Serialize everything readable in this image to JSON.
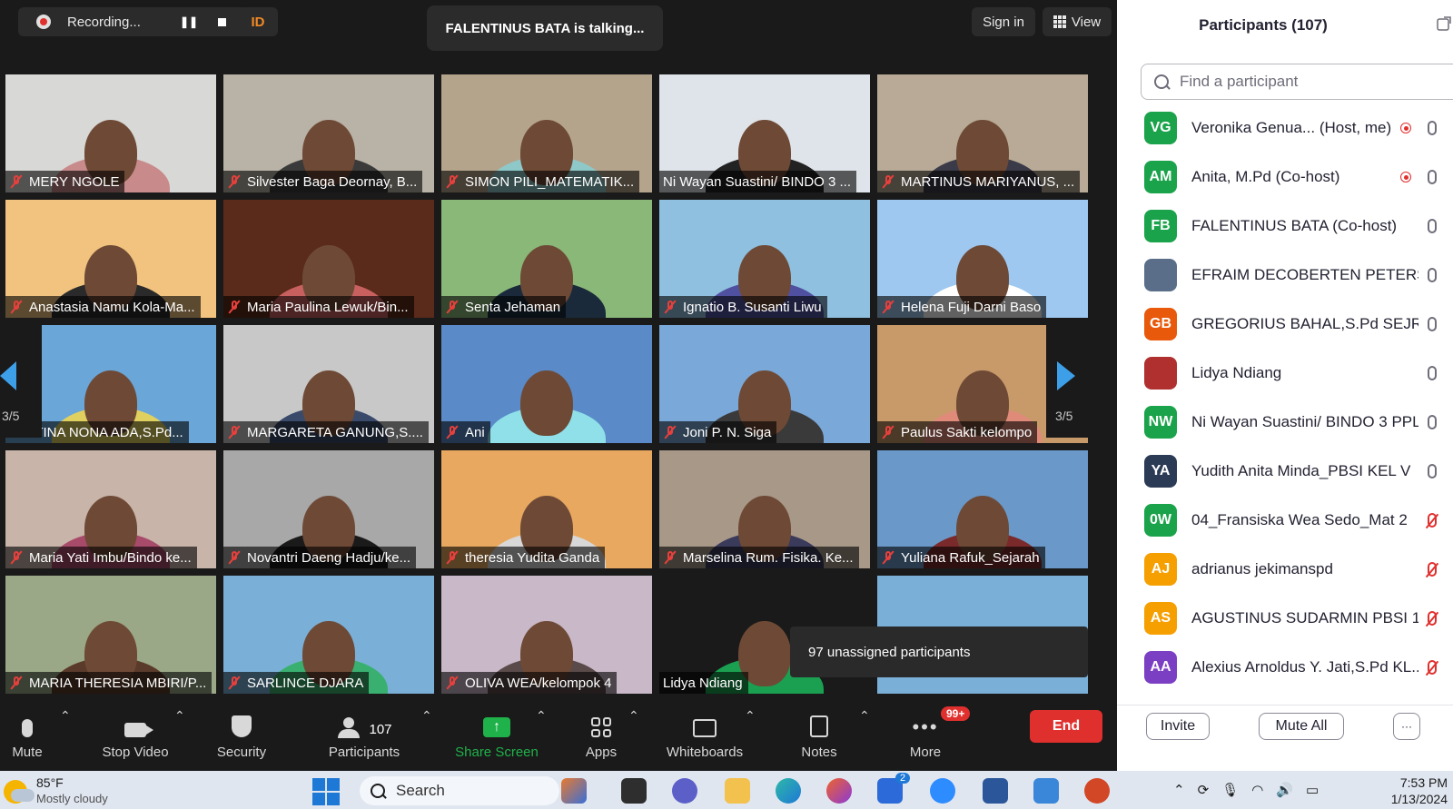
{
  "topbar": {
    "recording_label": "Recording...",
    "id_label": "ID",
    "talking_label": "FALENTINUS BATA is talking...",
    "sign_in_label": "Sign in",
    "view_label": "View"
  },
  "grid": {
    "page_indicator": "3/5",
    "unassigned_label": "97 unassigned participants",
    "tiles": [
      {
        "name": "MERY NGOLE",
        "muted": true
      },
      {
        "name": "Silvester Baga Deornay, B...",
        "muted": true
      },
      {
        "name": "SIMON PILI_MATEMATIK...",
        "muted": true
      },
      {
        "name": "Ni Wayan Suastini/ BINDO 3 ...",
        "muted": false
      },
      {
        "name": "MARTINUS MARIYANUS, ...",
        "muted": true
      },
      {
        "name": "Anastasia Namu Kola-Ma...",
        "muted": true
      },
      {
        "name": "Maria Paulina Lewuk/Bin...",
        "muted": true
      },
      {
        "name": "Senta Jehaman",
        "muted": true
      },
      {
        "name": "Ignatio B. Susanti Liwu",
        "muted": true
      },
      {
        "name": "Helena Fuji Darni Baso",
        "muted": true
      },
      {
        "name": "JUSTINA NONA ADA,S.Pd...",
        "muted": false
      },
      {
        "name": "MARGARETA GANUNG,S....",
        "muted": true
      },
      {
        "name": "Ani",
        "muted": true
      },
      {
        "name": "Joni P. N. Siga",
        "muted": true
      },
      {
        "name": "Paulus Sakti  kelompo",
        "muted": true
      },
      {
        "name": "Maria Yati Imbu/Bindo ke...",
        "muted": true
      },
      {
        "name": "Novantri Daeng Hadju/ke...",
        "muted": true
      },
      {
        "name": "theresia Yudita Ganda",
        "muted": true
      },
      {
        "name": "Marselina Rum. Fisika. Ke...",
        "muted": true
      },
      {
        "name": "Yuliana Rafuk_Sejarah",
        "muted": true
      },
      {
        "name": "MARIA THERESIA MBIRI/P...",
        "muted": true
      },
      {
        "name": "SARLINCE DJARA",
        "muted": true
      },
      {
        "name": "OLIVA WEA/kelompok 4",
        "muted": true
      },
      {
        "name": "Lidya Ndiang",
        "muted": false
      },
      {
        "name": "",
        "muted": false
      }
    ]
  },
  "toolbar": {
    "mute": "Mute",
    "stop_video": "Stop Video",
    "security": "Security",
    "participants": "Participants",
    "participants_count": "107",
    "share_screen": "Share Screen",
    "apps": "Apps",
    "whiteboards": "Whiteboards",
    "notes": "Notes",
    "more": "More",
    "more_badge": "99+",
    "end": "End"
  },
  "panel": {
    "title": "Participants (107)",
    "search_placeholder": "Find a participant",
    "participants": [
      {
        "initials": "VG",
        "color": "#1aa34a",
        "name": "Veronika Genua...   (Host, me)",
        "recording": true,
        "mic": "on"
      },
      {
        "initials": "AM",
        "color": "#1aa34a",
        "name": "Anita, M.Pd (Co-host)",
        "recording": true,
        "mic": "on"
      },
      {
        "initials": "FB",
        "color": "#1aa34a",
        "name": "FALENTINUS BATA (Co-host)",
        "recording": false,
        "mic": "on"
      },
      {
        "initials": "",
        "color": "#5a6e8a",
        "name": "EFRAIM DECOBERTEN PETERS k...",
        "recording": false,
        "mic": "on"
      },
      {
        "initials": "GB",
        "color": "#e8590c",
        "name": "GREGORIUS BAHAL,S.Pd SEJRH...",
        "recording": false,
        "mic": "on"
      },
      {
        "initials": "",
        "color": "#b03030",
        "name": "Lidya Ndiang",
        "recording": false,
        "mic": "on"
      },
      {
        "initials": "NW",
        "color": "#1aa34a",
        "name": "Ni Wayan Suastini/ BINDO 3 PPL",
        "recording": false,
        "mic": "on"
      },
      {
        "initials": "YA",
        "color": "#2b3a55",
        "name": "Yudith Anita Minda_PBSI KEL V",
        "recording": false,
        "mic": "on"
      },
      {
        "initials": "0W",
        "color": "#1aa34a",
        "name": "04_Fransiska Wea Sedo_Mat 2",
        "recording": false,
        "mic": "muted"
      },
      {
        "initials": "AJ",
        "color": "#f59f00",
        "name": "adrianus jekimanspd",
        "recording": false,
        "mic": "muted"
      },
      {
        "initials": "AS",
        "color": "#f59f00",
        "name": "AGUSTINUS SUDARMIN PBSI 1",
        "recording": false,
        "mic": "muted"
      },
      {
        "initials": "AA",
        "color": "#7b3fc4",
        "name": "Alexius Arnoldus Y. Jati,S.Pd KL...",
        "recording": false,
        "mic": "muted"
      }
    ],
    "invite": "Invite",
    "mute_all": "Mute All",
    "more_dots": "···"
  },
  "taskbar": {
    "temperature": "85°F",
    "weather": "Mostly cloudy",
    "search_label": "Search",
    "store_badge": "2",
    "time": "7:53 PM",
    "date": "1/13/2024"
  },
  "colors": {
    "accent_blue": "#3d9fe8",
    "end_red": "#e0302e",
    "share_green": "#1fb24a",
    "mic_muted_red": "#e8403c"
  }
}
